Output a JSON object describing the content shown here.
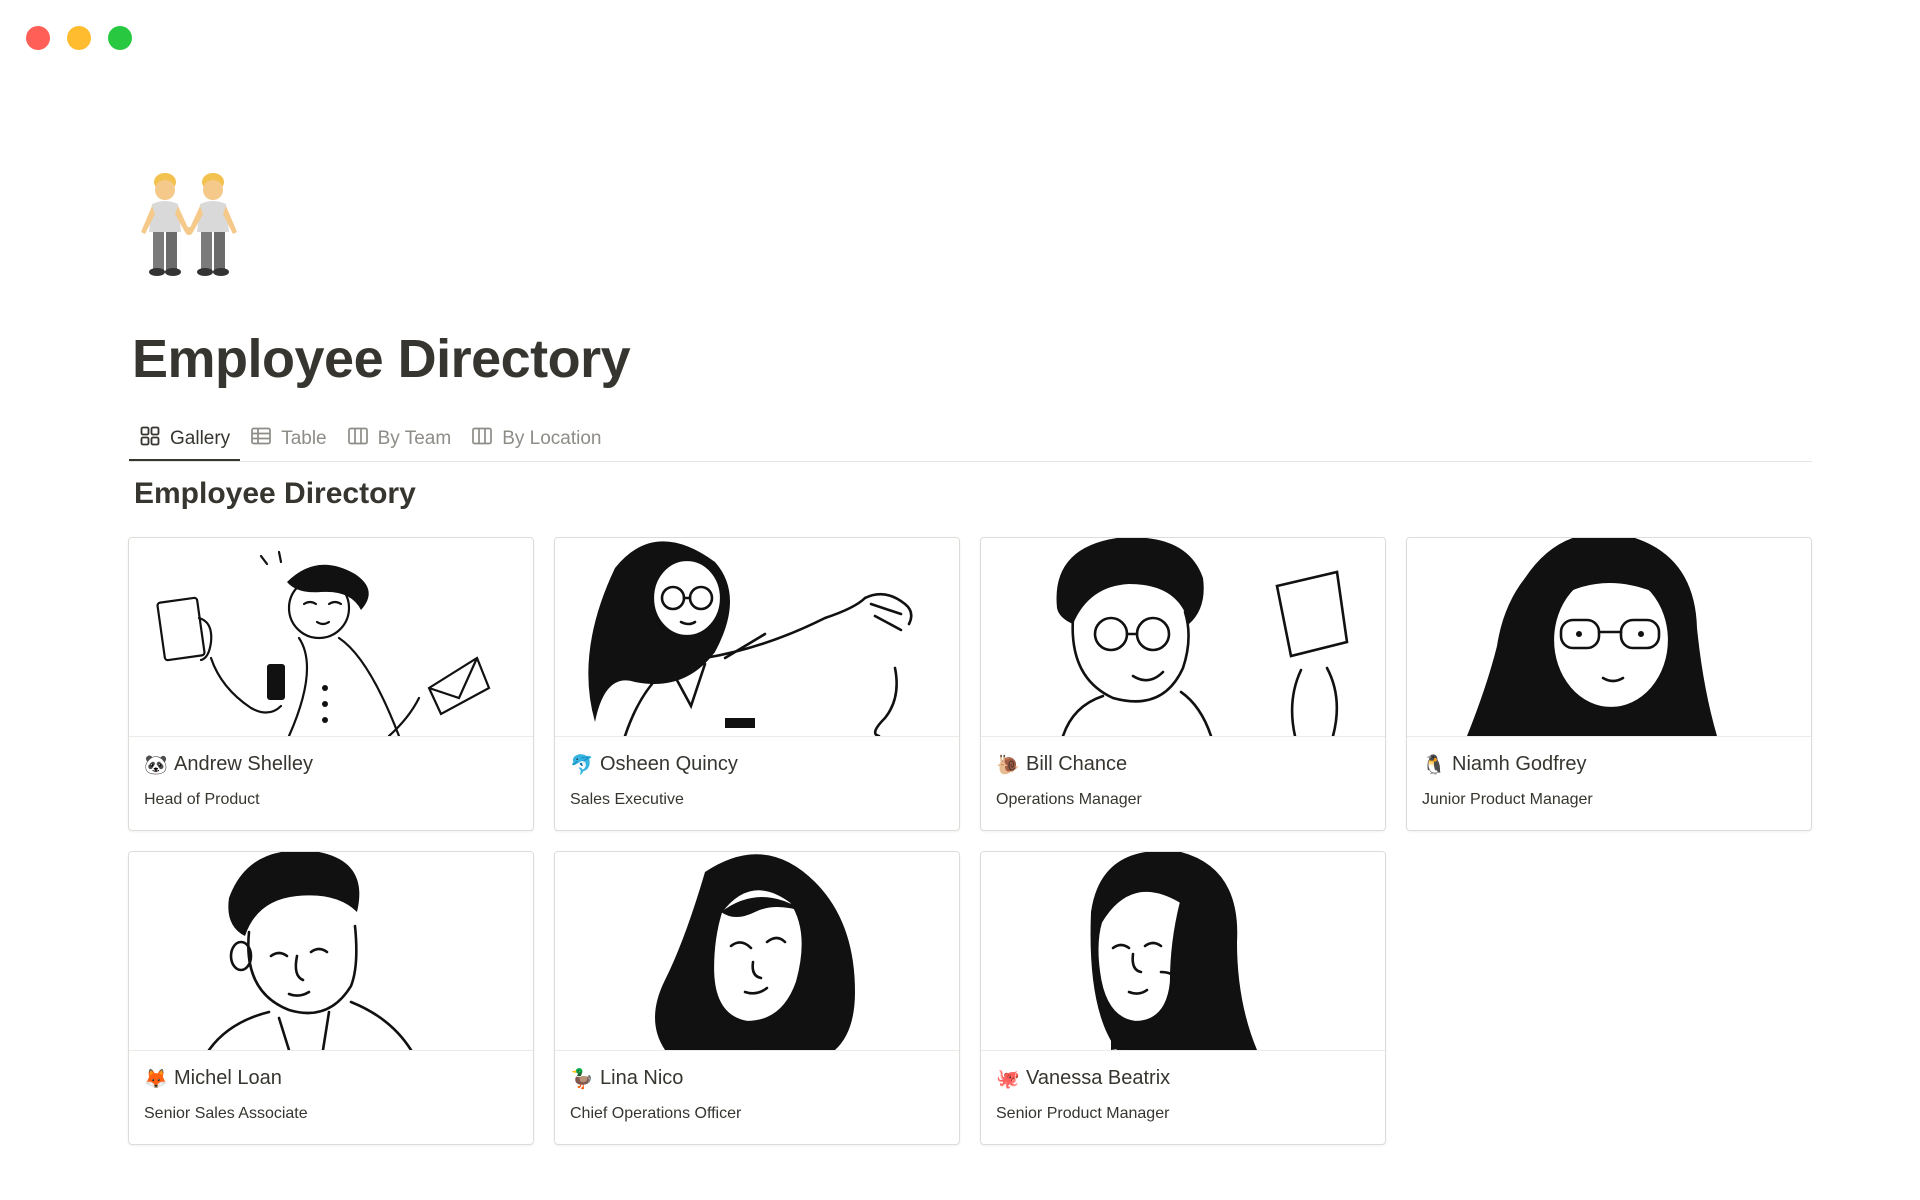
{
  "window": {
    "controls": [
      "close",
      "minimize",
      "maximize"
    ]
  },
  "page": {
    "icon": "two-people-holding-hands-icon",
    "title": "Employee Directory"
  },
  "tabs": [
    {
      "label": "Gallery",
      "icon": "gallery-grid-icon",
      "active": true
    },
    {
      "label": "Table",
      "icon": "table-icon",
      "active": false
    },
    {
      "label": "By Team",
      "icon": "board-columns-icon",
      "active": false
    },
    {
      "label": "By Location",
      "icon": "board-columns-icon",
      "active": false
    }
  ],
  "view": {
    "title": "Employee Directory",
    "employees": [
      {
        "emoji": "🐼",
        "name": "Andrew Shelley",
        "role": "Head of Product"
      },
      {
        "emoji": "🐬",
        "name": "Osheen Quincy",
        "role": "Sales Executive"
      },
      {
        "emoji": "🐌",
        "name": "Bill Chance",
        "role": "Operations Manager"
      },
      {
        "emoji": "🐧",
        "name": "Niamh Godfrey",
        "role": "Junior Product Manager"
      },
      {
        "emoji": "🦊",
        "name": "Michel Loan",
        "role": "Senior Sales Associate"
      },
      {
        "emoji": "🦆",
        "name": "Lina Nico",
        "role": "Chief Operations Officer"
      },
      {
        "emoji": "🐙",
        "name": "Vanessa Beatrix",
        "role": "Senior Product Manager"
      }
    ]
  },
  "colors": {
    "text": "#37352f",
    "muted_text": "#8e8c87",
    "border": "#dedcd8",
    "close": "#ff5f57",
    "minimize": "#febc2e",
    "maximize": "#28c840"
  }
}
